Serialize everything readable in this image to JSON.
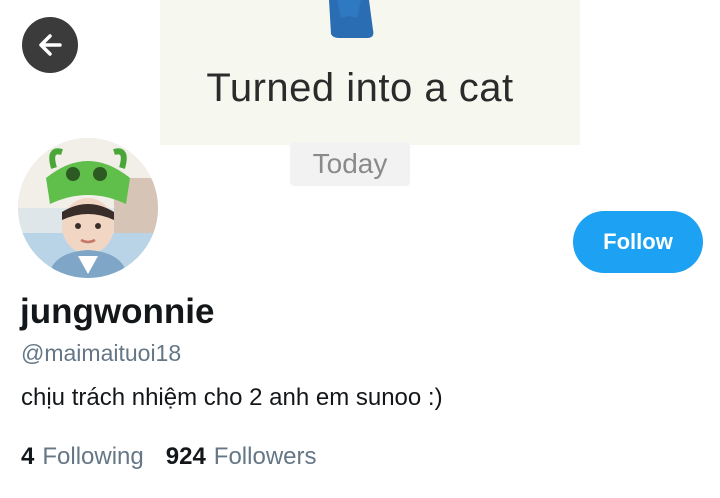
{
  "banner": {
    "title": "Turned into a cat",
    "date_label": "Today",
    "icon": "cat-icon",
    "icon_color": "#2a6db3"
  },
  "nav": {
    "back_icon": "arrow-left-icon"
  },
  "profile": {
    "avatar_icon": "avatar-photo",
    "display_name": "jungwonnie",
    "handle": "@maimaituoi18",
    "bio": "chịu trách nhiệm cho 2 anh em sunoo :)",
    "follow_label": "Follow",
    "following_count": "4",
    "following_label": "Following",
    "followers_count": "924",
    "followers_label": "Followers"
  },
  "colors": {
    "accent": "#1da1f2",
    "secondary_text": "#657786",
    "primary_text": "#14171a"
  }
}
